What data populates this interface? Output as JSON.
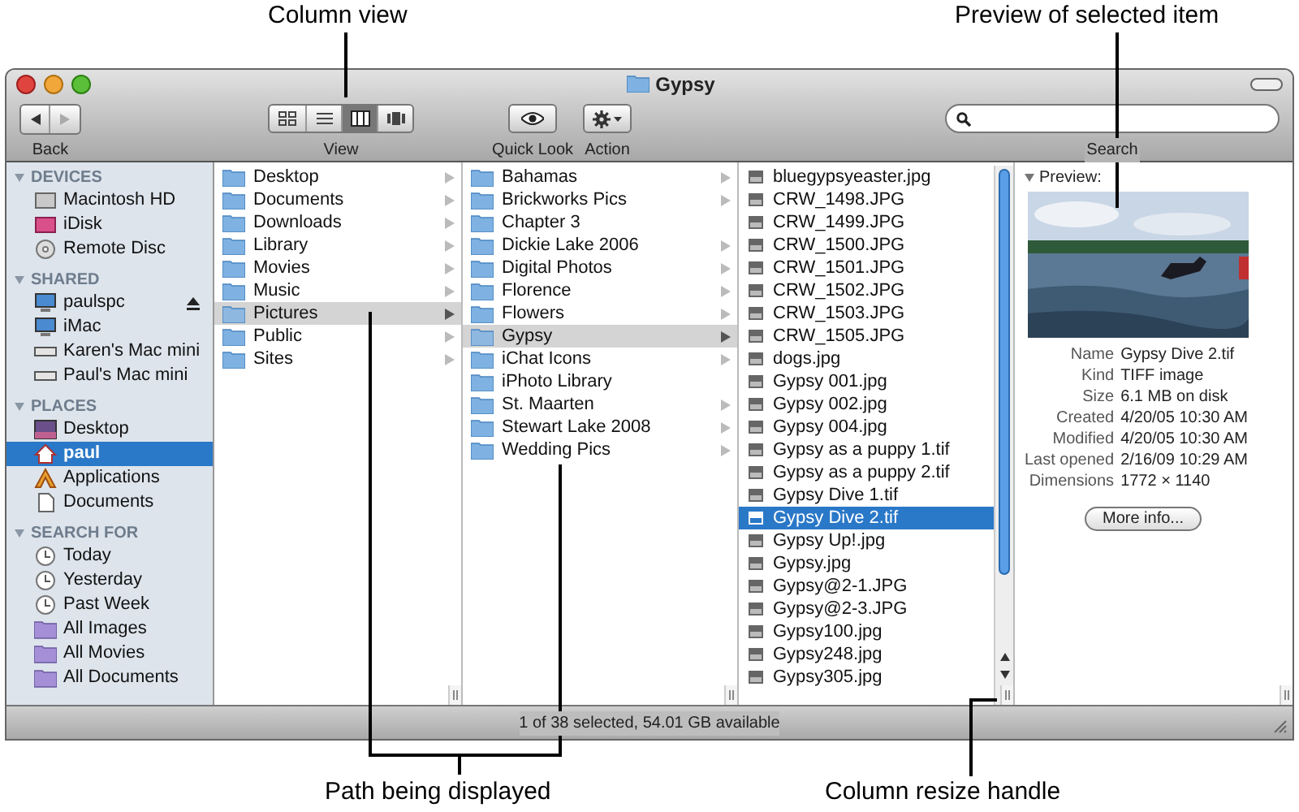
{
  "annotations": [
    {
      "text": "Column view"
    },
    {
      "text": "Preview of selected item"
    },
    {
      "text": "Path being displayed"
    },
    {
      "text": "Column resize handle"
    }
  ],
  "window": {
    "title": "Gypsy"
  },
  "toolbar": {
    "back_label": "Back",
    "view_label": "View",
    "view_buttons": [
      {
        "kind": "icons",
        "selected": false
      },
      {
        "kind": "list",
        "selected": false
      },
      {
        "kind": "columns",
        "selected": true
      },
      {
        "kind": "coverflow",
        "selected": false
      }
    ],
    "quicklook_label": "Quick Look",
    "action_label": "Action",
    "search_label": "Search"
  },
  "sidebar": {
    "sections": [
      {
        "title": "DEVICES",
        "items": [
          {
            "label": "Macintosh HD",
            "kind": "drive",
            "selected": false,
            "eject": false
          },
          {
            "label": "iDisk",
            "kind": "idisk",
            "selected": false,
            "eject": false
          },
          {
            "label": "Remote Disc",
            "kind": "disc",
            "selected": false,
            "eject": false
          }
        ]
      },
      {
        "title": "SHARED",
        "items": [
          {
            "label": "paulspc",
            "kind": "computer",
            "selected": false,
            "eject": true
          },
          {
            "label": "iMac",
            "kind": "computer",
            "selected": false,
            "eject": false
          },
          {
            "label": "Karen's Mac mini",
            "kind": "server",
            "selected": false,
            "eject": false
          },
          {
            "label": "Paul's Mac mini",
            "kind": "server",
            "selected": false,
            "eject": false
          }
        ]
      },
      {
        "title": "PLACES",
        "items": [
          {
            "label": "Desktop",
            "kind": "desktop",
            "selected": false,
            "eject": false
          },
          {
            "label": "paul",
            "kind": "home",
            "selected": true,
            "eject": false
          },
          {
            "label": "Applications",
            "kind": "apps",
            "selected": false,
            "eject": false
          },
          {
            "label": "Documents",
            "kind": "doc",
            "selected": false,
            "eject": false
          }
        ]
      },
      {
        "title": "SEARCH FOR",
        "items": [
          {
            "label": "Today",
            "kind": "clock",
            "selected": false,
            "eject": false
          },
          {
            "label": "Yesterday",
            "kind": "clock",
            "selected": false,
            "eject": false
          },
          {
            "label": "Past Week",
            "kind": "clock",
            "selected": false,
            "eject": false
          },
          {
            "label": "All Images",
            "kind": "smart",
            "selected": false,
            "eject": false
          },
          {
            "label": "All Movies",
            "kind": "smart",
            "selected": false,
            "eject": false
          },
          {
            "label": "All Documents",
            "kind": "smart",
            "selected": false,
            "eject": false
          }
        ]
      }
    ]
  },
  "columns": [
    {
      "items": [
        {
          "name": "Desktop",
          "selected": false,
          "expandable": true
        },
        {
          "name": "Documents",
          "selected": false,
          "expandable": true
        },
        {
          "name": "Downloads",
          "selected": false,
          "expandable": true
        },
        {
          "name": "Library",
          "selected": false,
          "expandable": true
        },
        {
          "name": "Movies",
          "selected": false,
          "expandable": true
        },
        {
          "name": "Music",
          "selected": false,
          "expandable": true
        },
        {
          "name": "Pictures",
          "selected": true,
          "expandable": true
        },
        {
          "name": "Public",
          "selected": false,
          "expandable": true
        },
        {
          "name": "Sites",
          "selected": false,
          "expandable": true
        }
      ]
    },
    {
      "items": [
        {
          "name": "Bahamas",
          "selected": false,
          "expandable": true
        },
        {
          "name": "Brickworks Pics",
          "selected": false,
          "expandable": true
        },
        {
          "name": "Chapter 3",
          "selected": false,
          "expandable": false
        },
        {
          "name": "Dickie Lake 2006",
          "selected": false,
          "expandable": true
        },
        {
          "name": "Digital Photos",
          "selected": false,
          "expandable": true
        },
        {
          "name": "Florence",
          "selected": false,
          "expandable": true
        },
        {
          "name": "Flowers",
          "selected": false,
          "expandable": true
        },
        {
          "name": "Gypsy",
          "selected": true,
          "expandable": true
        },
        {
          "name": "iChat Icons",
          "selected": false,
          "expandable": true
        },
        {
          "name": "iPhoto Library",
          "selected": false,
          "expandable": false
        },
        {
          "name": "St. Maarten",
          "selected": false,
          "expandable": true
        },
        {
          "name": "Stewart Lake 2008",
          "selected": false,
          "expandable": true
        },
        {
          "name": "Wedding Pics",
          "selected": false,
          "expandable": true
        }
      ]
    }
  ],
  "files": [
    {
      "name": "bluegypsyeaster.jpg",
      "selected": false
    },
    {
      "name": "CRW_1498.JPG",
      "selected": false
    },
    {
      "name": "CRW_1499.JPG",
      "selected": false
    },
    {
      "name": "CRW_1500.JPG",
      "selected": false
    },
    {
      "name": "CRW_1501.JPG",
      "selected": false
    },
    {
      "name": "CRW_1502.JPG",
      "selected": false
    },
    {
      "name": "CRW_1503.JPG",
      "selected": false
    },
    {
      "name": "CRW_1505.JPG",
      "selected": false
    },
    {
      "name": "dogs.jpg",
      "selected": false
    },
    {
      "name": "Gypsy 001.jpg",
      "selected": false
    },
    {
      "name": "Gypsy 002.jpg",
      "selected": false
    },
    {
      "name": "Gypsy 004.jpg",
      "selected": false
    },
    {
      "name": "Gypsy as a puppy 1.tif",
      "selected": false
    },
    {
      "name": "Gypsy as a puppy 2.tif",
      "selected": false
    },
    {
      "name": "Gypsy Dive 1.tif",
      "selected": false
    },
    {
      "name": "Gypsy Dive 2.tif",
      "selected": true
    },
    {
      "name": "Gypsy Up!.jpg",
      "selected": false
    },
    {
      "name": "Gypsy.jpg",
      "selected": false
    },
    {
      "name": "Gypsy@2-1.JPG",
      "selected": false
    },
    {
      "name": "Gypsy@2-3.JPG",
      "selected": false
    },
    {
      "name": "Gypsy100.jpg",
      "selected": false
    },
    {
      "name": "Gypsy248.jpg",
      "selected": false
    },
    {
      "name": "Gypsy305.jpg",
      "selected": false
    }
  ],
  "preview": {
    "heading": "Preview:",
    "fields": [
      {
        "label": "Name",
        "value": "Gypsy Dive 2.tif"
      },
      {
        "label": "Kind",
        "value": "TIFF image"
      },
      {
        "label": "Size",
        "value": "6.1 MB on disk"
      },
      {
        "label": "Created",
        "value": "4/20/05 10:30 AM"
      },
      {
        "label": "Modified",
        "value": "4/20/05 10:30 AM"
      },
      {
        "label": "Last opened",
        "value": "2/16/09 10:29 AM"
      },
      {
        "label": "Dimensions",
        "value": "1772 × 1140"
      }
    ],
    "button": "More info..."
  },
  "status_bar": {
    "text": "1 of 38 selected, 54.01 GB available"
  }
}
